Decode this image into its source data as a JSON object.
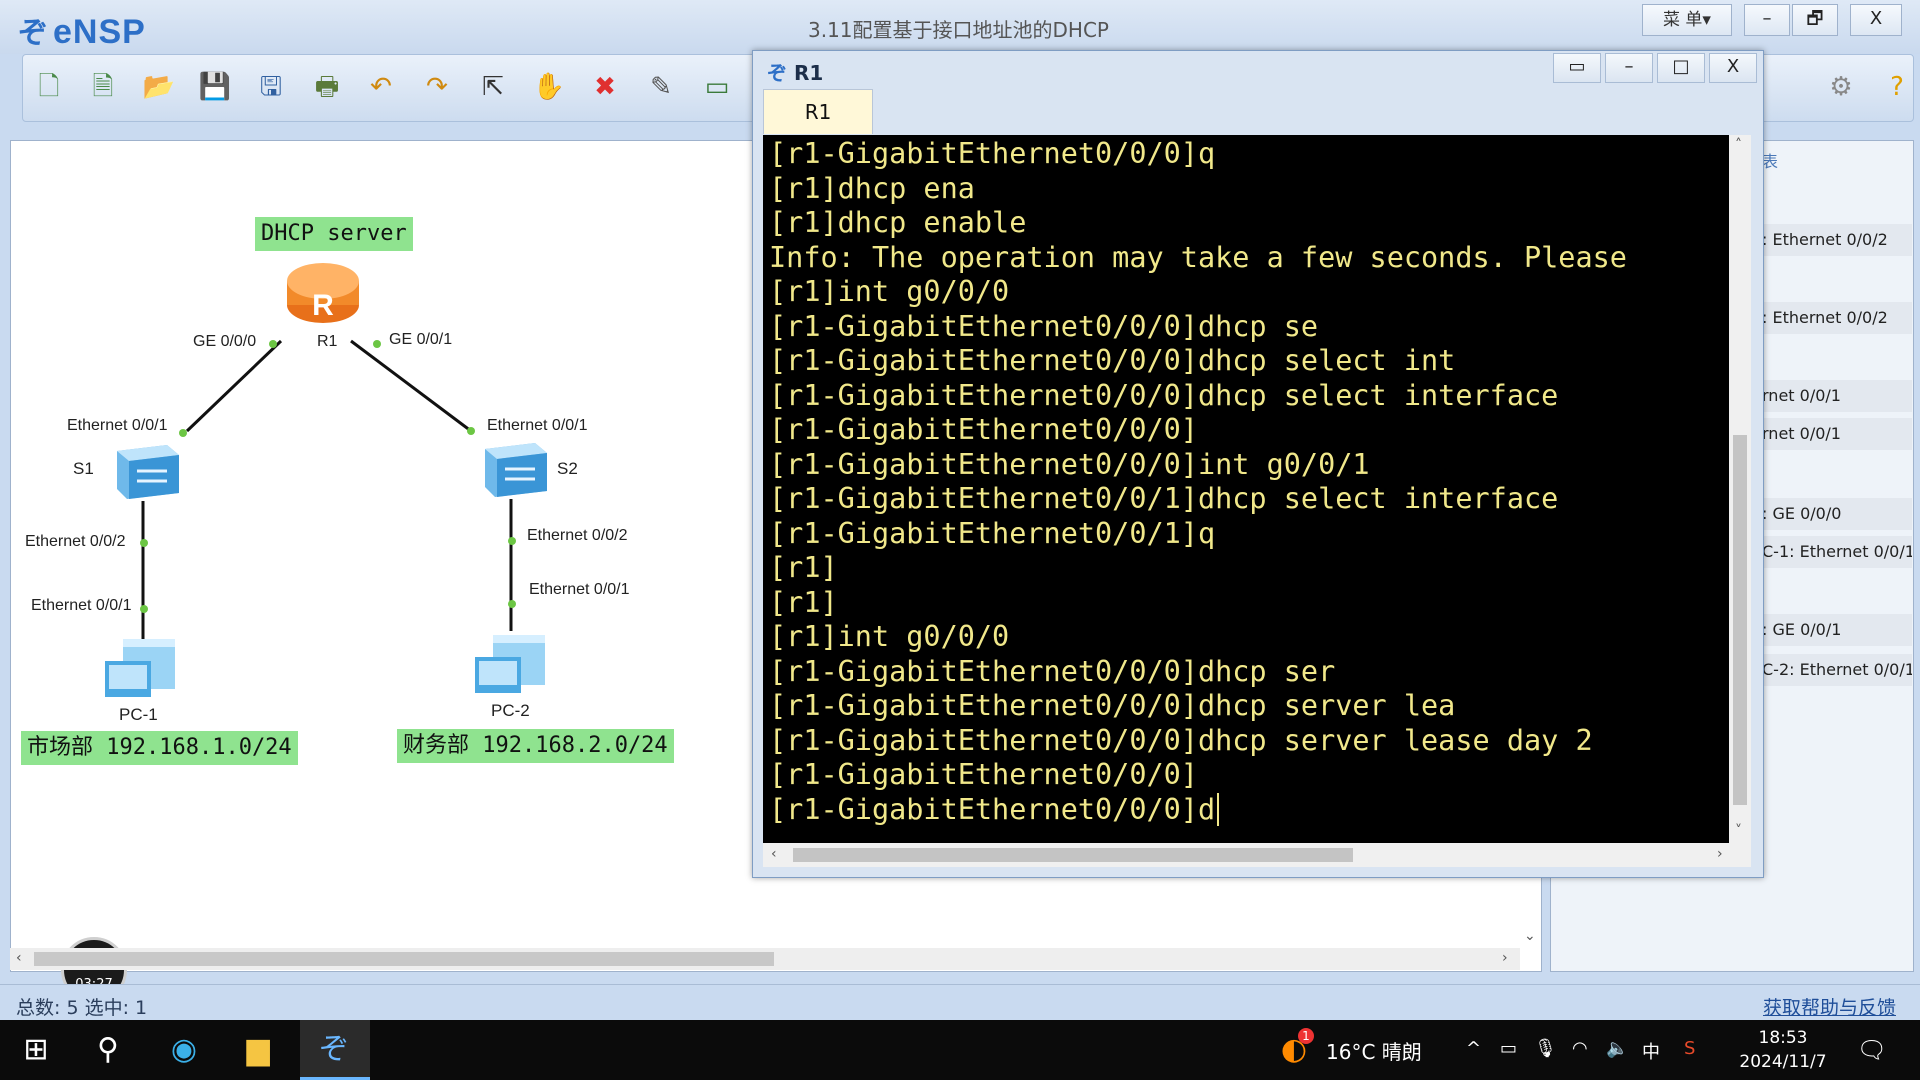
{
  "app": {
    "name": "eNSP",
    "window_title": "3.11配置基于接口地址池的DHCP",
    "menu_label": "菜 单▾",
    "controls": [
      "–",
      "🗗",
      "X"
    ]
  },
  "toolbar": {
    "icons": [
      "new-topology-icon",
      "new-lab-icon",
      "open-icon",
      "save-icon",
      "save-as-icon",
      "print-icon",
      "undo-icon",
      "redo-icon",
      "select-icon",
      "pan-hand-icon",
      "delete-icon",
      "erase-link-icon",
      "add-note-icon",
      "settings-icon",
      "help-icon"
    ]
  },
  "topology": {
    "server_label": "DHCP server",
    "router": {
      "name": "R1",
      "letter": "R",
      "port_left": "GE 0/0/0",
      "port_right": "GE 0/0/1"
    },
    "s1": {
      "name": "S1",
      "port_up": "Ethernet 0/0/1",
      "port_down": "Ethernet 0/0/2"
    },
    "s2": {
      "name": "S2",
      "port_up": "Ethernet 0/0/1",
      "port_down": "Ethernet 0/0/2"
    },
    "pc1": {
      "name": "PC-1",
      "port": "Ethernet 0/0/1"
    },
    "pc2": {
      "name": "PC-2",
      "port": "Ethernet 0/0/1"
    },
    "net1": "市场部 192.168.1.0/24",
    "net2": "财务部 192.168.2.0/24",
    "timer": "03:27"
  },
  "side_panel": {
    "header_fragment": "表",
    "items": [
      ": Ethernet 0/0/2",
      ": Ethernet 0/0/2",
      "rnet 0/0/1",
      "rnet 0/0/1",
      ": GE 0/0/0",
      "C-1: Ethernet 0/0/1",
      ": GE 0/0/1",
      "C-2: Ethernet 0/0/1"
    ]
  },
  "status": {
    "text": "总数: 5  选中: 1",
    "help": "获取帮助与反馈"
  },
  "console": {
    "title": "R1",
    "tab": "R1",
    "lines": [
      "[r1-GigabitEthernet0/0/0]q",
      "[r1]dhcp ena",
      "[r1]dhcp enable",
      "Info: The operation may take a few seconds. Please",
      "[r1]int g0/0/0",
      "[r1-GigabitEthernet0/0/0]dhcp se",
      "[r1-GigabitEthernet0/0/0]dhcp select int",
      "[r1-GigabitEthernet0/0/0]dhcp select interface",
      "[r1-GigabitEthernet0/0/0]",
      "[r1-GigabitEthernet0/0/0]int g0/0/1",
      "[r1-GigabitEthernet0/0/1]dhcp select interface",
      "[r1-GigabitEthernet0/0/1]q",
      "[r1]",
      "[r1]",
      "[r1]int g0/0/0",
      "[r1-GigabitEthernet0/0/0]dhcp ser",
      "[r1-GigabitEthernet0/0/0]dhcp server lea",
      "[r1-GigabitEthernet0/0/0]dhcp server lease day 2",
      "[r1-GigabitEthernet0/0/0]",
      "[r1-GigabitEthernet0/0/0]d"
    ]
  },
  "taskbar": {
    "weather": "16°C  晴朗",
    "ime": "中",
    "time": "18:53",
    "date": "2024/11/7",
    "badge": "1"
  }
}
